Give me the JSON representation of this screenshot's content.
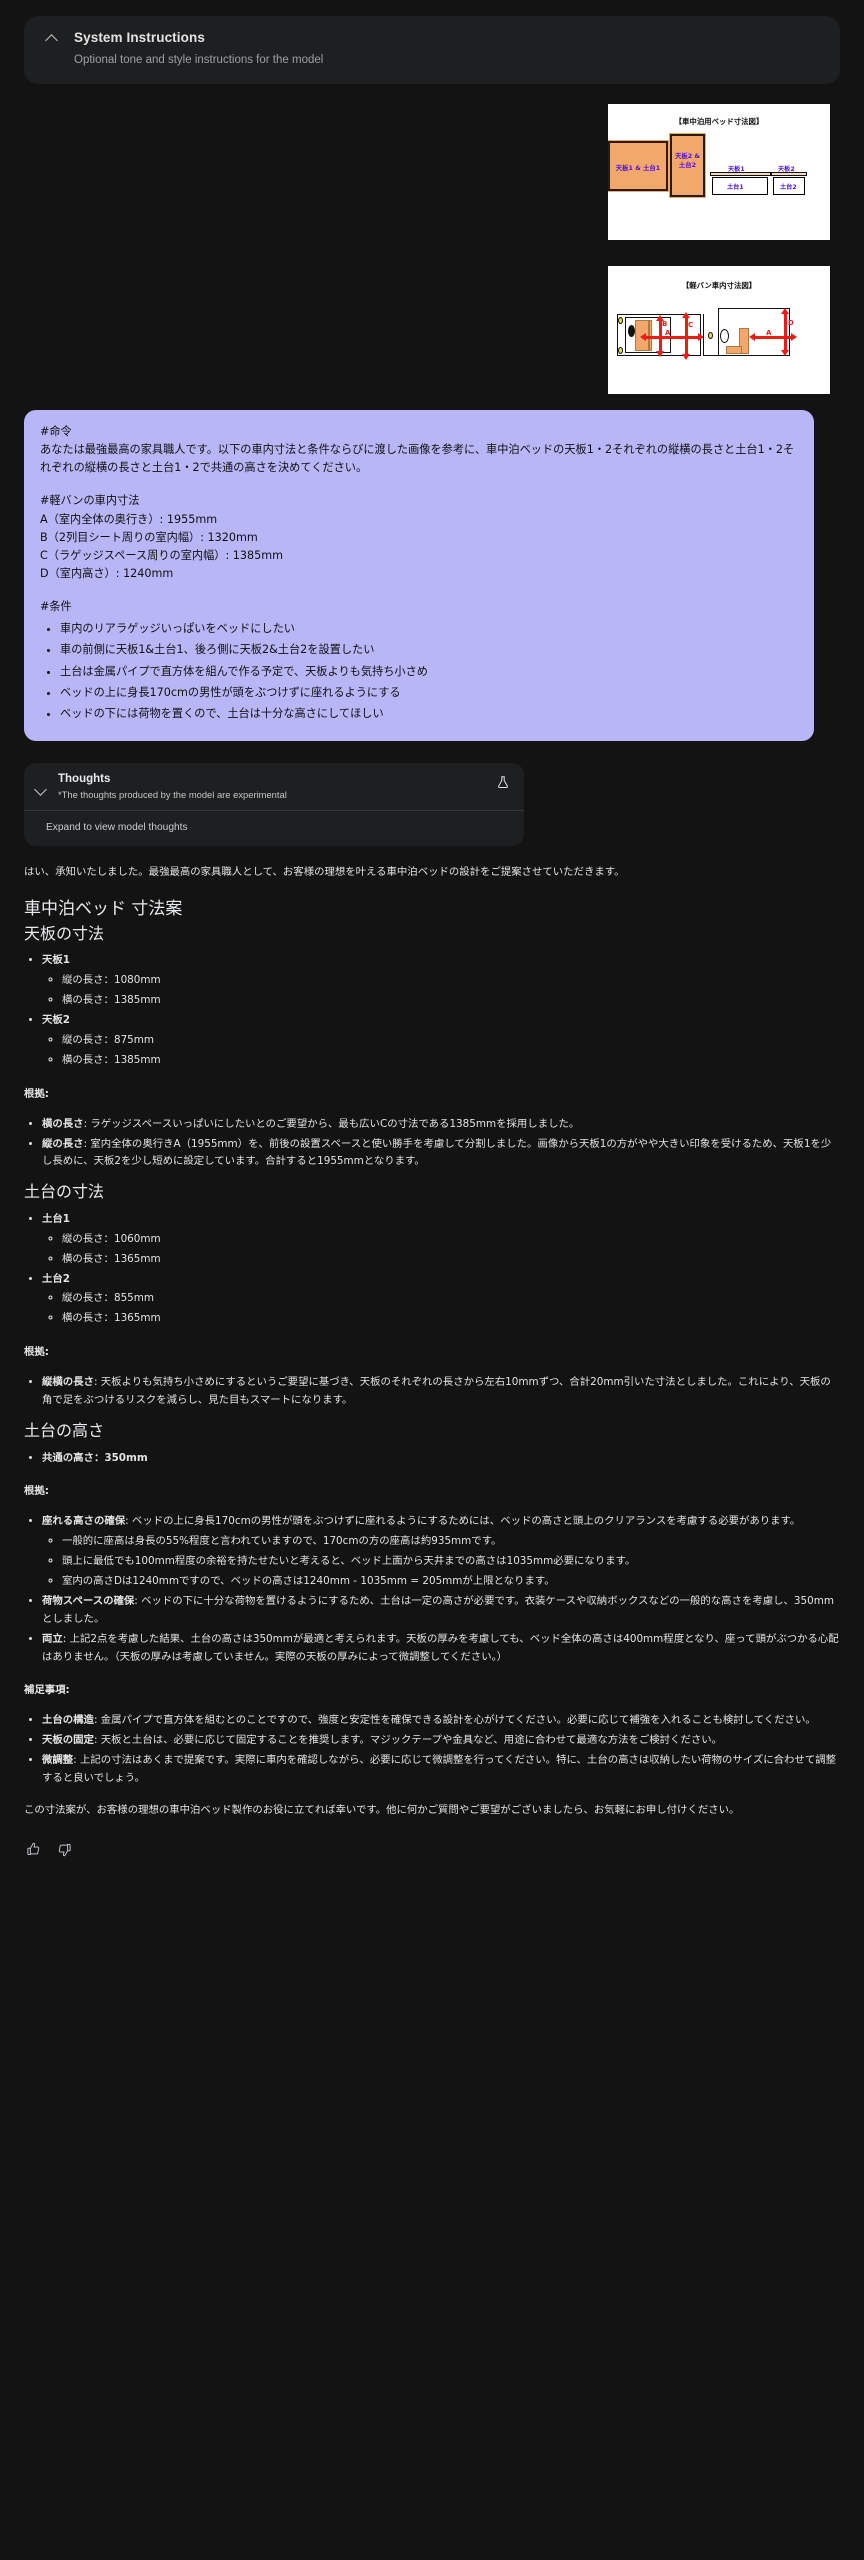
{
  "system_instructions": {
    "title": "System Instructions",
    "placeholder": "Optional tone and style instructions for the model",
    "chevron": "chevron-up-icon"
  },
  "images": {
    "bed_diagram": {
      "title": "【車中泊用ベッド寸法図】",
      "block_a_label": "天板1 & 土台1",
      "block_b_label": "天板2\n&\n土台2",
      "cap_top1": "天板1",
      "cap_top2": "天板2",
      "cap_base1": "土台1",
      "cap_base2": "土台2"
    },
    "van_diagram": {
      "title": "【軽バン車内寸法図】",
      "labels": [
        "A",
        "B",
        "C",
        "A",
        "D"
      ]
    }
  },
  "prompt": {
    "heading_order": "#命令",
    "order_body": "あなたは最強最高の家具職人です。以下の車内寸法と条件ならびに渡した画像を参考に、車中泊ベッドの天板1・2それぞれの縦横の長さと土台1・2それぞれの縦横の長さと土台1・2で共通の高さを決めてください。",
    "heading_dims": "#軽バンの車内寸法",
    "dims": [
      "A（室内全体の奥行き）: 1955mm",
      "B（2列目シート周りの室内幅）: 1320mm",
      "C（ラゲッジスペース周りの室内幅）: 1385mm",
      "D（室内高さ）: 1240mm"
    ],
    "heading_cond": "#条件",
    "conditions": [
      "車内のリアラゲッジいっぱいをベッドにしたい",
      "車の前側に天板1&土台1、後ろ側に天板2&土台2を設置したい",
      "土台は金属パイプで直方体を組んで作る予定で、天板よりも気持ち小さめ",
      "ベッドの上に身長170cmの男性が頭をぶつけずに座れるようにする",
      "ベッドの下には荷物を置くので、土台は十分な高さにしてほしい"
    ]
  },
  "thoughts": {
    "title": "Thoughts",
    "subtitle": "*The thoughts produced by the model are experimental",
    "expand_label": "Expand to view model thoughts",
    "chevron": "chevron-down-icon",
    "icon": "flask-icon"
  },
  "response": {
    "lead": "はい、承知いたしました。最強最高の家具職人として、お客様の理想を叶える車中泊ベッドの設計をご提案させていただきます。",
    "h_main": "車中泊ベッド 寸法案",
    "h_tenban": "天板の寸法",
    "tenban1": "天板1",
    "tenban1_tate": "縦の長さ：1080mm",
    "tenban1_yoko": "横の長さ：1385mm",
    "tenban2": "天板2",
    "tenban2_tate": "縦の長さ：875mm",
    "tenban2_yoko": "横の長さ：1385mm",
    "konkyo1_label": "根拠:",
    "konkyo1_b1_key": "横の長さ",
    "konkyo1_b1_val": ": ラゲッジスペースいっぱいにしたいとのご要望から、最も広いCの寸法である1385mmを採用しました。",
    "konkyo1_b2_key": "縦の長さ",
    "konkyo1_b2_val": ": 室内全体の奥行きA（1955mm）を、前後の設置スペースと使い勝手を考慮して分割しました。画像から天板1の方がやや大きい印象を受けるため、天板1を少し長めに、天板2を少し短めに設定しています。合計すると1955mmとなります。",
    "h_dodai": "土台の寸法",
    "dodai1": "土台1",
    "dodai1_tate": "縦の長さ：1060mm",
    "dodai1_yoko": "横の長さ：1365mm",
    "dodai2": "土台2",
    "dodai2_tate": "縦の長さ：855mm",
    "dodai2_yoko": "横の長さ：1365mm",
    "konkyo2_label": "根拠:",
    "konkyo2_b1_key": "縦横の長さ",
    "konkyo2_b1_val": ": 天板よりも気持ち小さめにするというご要望に基づき、天板のそれぞれの長さから左右10mmずつ、合計20mm引いた寸法としました。これにより、天板の角で足をぶつけるリスクを減らし、見た目もスマートになります。",
    "h_takasa": "土台の高さ",
    "takasa_common": "共通の高さ：350mm",
    "konkyo3_label": "根拠:",
    "konkyo3_b1_key": "座れる高さの確保",
    "konkyo3_b1_val": ": ベッドの上に身長170cmの男性が頭をぶつけずに座れるようにするためには、ベッドの高さと頭上のクリアランスを考慮する必要があります。",
    "konkyo3_b1_s1": "一般的に座高は身長の55%程度と言われていますので、170cmの方の座高は約935mmです。",
    "konkyo3_b1_s2": "頭上に最低でも100mm程度の余裕を持たせたいと考えると、ベッド上面から天井までの高さは1035mm必要になります。",
    "konkyo3_b1_s3": "室内の高さDは1240mmですので、ベッドの高さは1240mm - 1035mm = 205mmが上限となります。",
    "konkyo3_b2_key": "荷物スペースの確保",
    "konkyo3_b2_val": ": ベッドの下に十分な荷物を置けるようにするため、土台は一定の高さが必要です。衣装ケースや収納ボックスなどの一般的な高さを考慮し、350mmとしました。",
    "konkyo3_b3_key": "両立",
    "konkyo3_b3_val": ": 上記2点を考慮した結果、土台の高さは350mmが最適と考えられます。天板の厚みを考慮しても、ベッド全体の高さは400mm程度となり、座って頭がぶつかる心配はありません。（天板の厚みは考慮していません。実際の天板の厚みによって微調整してください。）",
    "hosoku_label": "補足事項:",
    "hosoku_b1_key": "土台の構造",
    "hosoku_b1_val": ": 金属パイプで直方体を組むとのことですので、強度と安定性を確保できる設計を心がけてください。必要に応じて補強を入れることも検討してください。",
    "hosoku_b2_key": "天板の固定",
    "hosoku_b2_val": ": 天板と土台は、必要に応じて固定することを推奨します。マジックテープや金具など、用途に合わせて最適な方法をご検討ください。",
    "hosoku_b3_key": "微調整",
    "hosoku_b3_val": ": 上記の寸法はあくまで提案です。実際に車内を確認しながら、必要に応じて微調整を行ってください。特に、土台の高さは収納したい荷物のサイズに合わせて調整すると良いでしょう。",
    "closing": "この寸法案が、お客様の理想の車中泊ベッド製作のお役に立てれば幸いです。他に何かご質問やご要望がございましたら、お気軽にお申し付けください。"
  },
  "feedback": {
    "thumb_up": "thumb-up-icon",
    "thumb_down": "thumb-down-icon"
  },
  "colors": {
    "page_bg": "#131314",
    "panel_bg": "#1e1f20",
    "bubble_bg": "#b9b6f7",
    "accent_orange": "#f2a86a",
    "accent_red": "#ee1c16",
    "label_purple": "#4b11d8"
  }
}
